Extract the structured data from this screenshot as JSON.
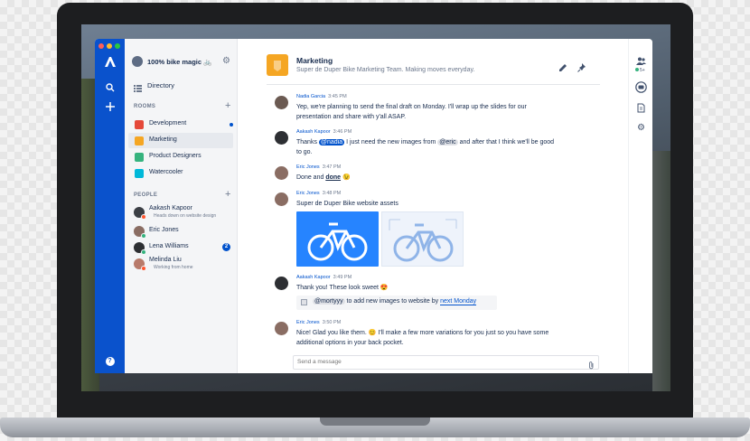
{
  "colors": {
    "brand": "#0052cc",
    "rail": "#0a52cc",
    "online": "#36b37e",
    "away": "#ff5630",
    "unread": "#0052cc"
  },
  "workspace": {
    "name": "100% bike magic 🚲"
  },
  "directory_label": "Directory",
  "rooms": {
    "title": "ROOMS",
    "items": [
      {
        "label": "Development",
        "icon_color": "#e5493a",
        "unread": true
      },
      {
        "label": "Marketing",
        "icon_color": "#f5a623",
        "selected": true
      },
      {
        "label": "Product Designers",
        "icon_color": "#36b37e"
      },
      {
        "label": "Watercooler",
        "icon_color": "#00b8d9"
      }
    ]
  },
  "people": {
    "title": "PEOPLE",
    "items": [
      {
        "name": "Aakash Kapoor",
        "status": "Heads down on website design"
      },
      {
        "name": "Eric Jones",
        "status": ""
      },
      {
        "name": "Lena Williams",
        "status": "",
        "badge": "2"
      },
      {
        "name": "Melinda Liu",
        "status": "Working from home"
      }
    ]
  },
  "room": {
    "name": "Marketing",
    "topic": "Super de Duper Bike Marketing Team. Making moves everyday."
  },
  "messages": [
    {
      "author": "Nadia Garcia",
      "time": "3:45 PM",
      "lines": [
        "Yep, we're planning to send the final draft on Monday. I'll wrap up the slides for our",
        "presentation and share with y'all ASAP."
      ]
    },
    {
      "author": "Aakash Kapoor",
      "time": "3:46 PM",
      "pre": "Thanks ",
      "mention": "@nadia",
      "mid": " I just need the new images from ",
      "mention2": "@eric",
      "post": " and after that I think we'll be good",
      "line2": "to go."
    },
    {
      "author": "Eric Jones",
      "time": "3:47 PM",
      "pre": "Done and ",
      "bold": "done",
      "post": " 😉"
    },
    {
      "author": "Eric Jones",
      "time": "3:48 PM",
      "text": "Super de Duper Bike website assets"
    },
    {
      "author": "Aakash Kapoor",
      "time": "3:49 PM",
      "text": "Thank you! These look sweet 😍",
      "task_mention": "@mortyyy",
      "task_text": " to add new images to website by ",
      "task_date": "next Monday"
    },
    {
      "author": "Eric Jones",
      "time": "3:50 PM",
      "lines": [
        "Nice! Glad you like them. 😊 I'll make a few more variations for you just so you have some",
        "additional options in your back pocket."
      ]
    }
  ],
  "composer": {
    "placeholder": "Send a message"
  },
  "rightbar": {
    "member_count": "5+"
  },
  "help_label": "?"
}
